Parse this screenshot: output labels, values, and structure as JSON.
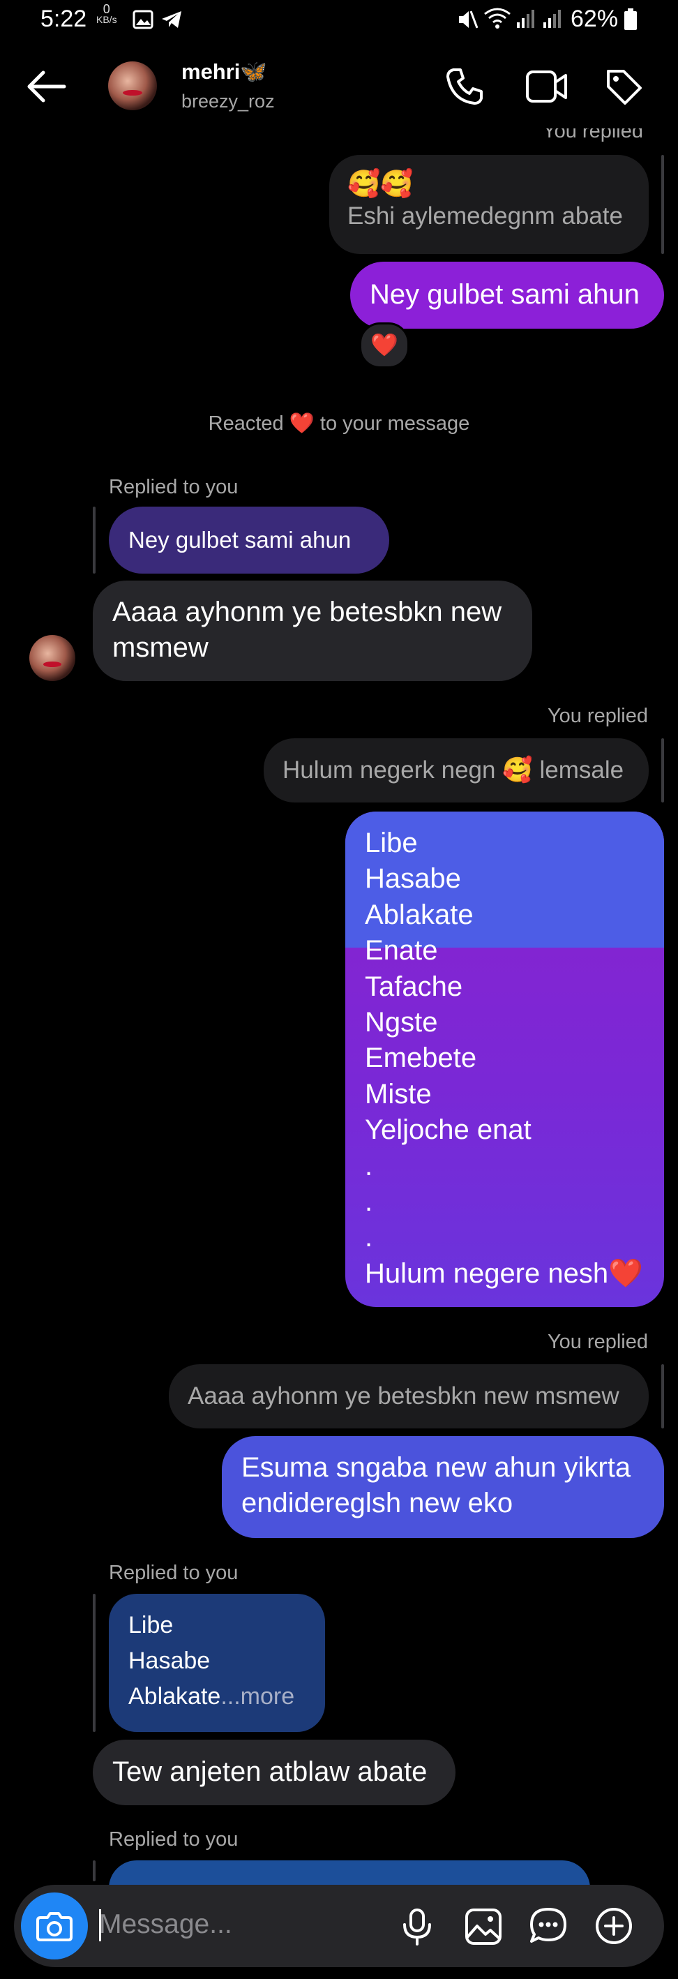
{
  "status_bar": {
    "time": "5:22",
    "speed_value": "0",
    "speed_unit": "KB/s",
    "battery": "62%"
  },
  "header": {
    "name": "mehri🦋",
    "username": "breezy_roz"
  },
  "thread": {
    "top_reply_label": "You replied",
    "top_quote_emojis": "🥰🥰",
    "top_quote_text": "Eshi aylemedegnm abate",
    "msg1": "Ney gulbet sami ahun",
    "msg1_reaction": "❤️",
    "reaction_notice_pre": "Reacted",
    "reaction_notice_emoji": "❤️",
    "reaction_notice_post": "to your message",
    "replied_to_you_1": "Replied to you",
    "their_quote_1": "Ney gulbet sami ahun",
    "their_msg_1_line1": "Aaaa ayhonm ye betesbkn new",
    "their_msg_1_line2": "msmew",
    "you_replied_2": "You replied",
    "quote_2": "Hulum negerk negn 🥰 lemsale",
    "list_lines": [
      "Libe",
      "Hasabe",
      "Ablakate",
      "Enate",
      "Tafache",
      "Ngste",
      "Emebete",
      "Miste",
      "Yeljoche enat",
      ".",
      ".",
      ".",
      "Hulum negere nesh❤️"
    ],
    "you_replied_3": "You replied",
    "quote_3": "Aaaa ayhonm ye betesbkn new msmew",
    "msg3_line1": "Esuma sngaba new ahun yikrta",
    "msg3_line2": "endidereglsh new eko",
    "replied_to_you_2": "Replied to you",
    "their_quote_2_lines": [
      "Libe",
      "Hasabe",
      "Ablakate"
    ],
    "their_quote_2_more": "...more",
    "their_msg_2": "Tew anjeten atblaw abate",
    "replied_to_you_3": "Replied to you"
  },
  "composer": {
    "placeholder": "Message..."
  },
  "colors": {
    "my_bubble_top": "#4d5de6",
    "my_bubble_bottom": "#8a24d2",
    "their_bubble": "#26262a",
    "quote_bubble": "#1b1b1d",
    "camera_button": "#1f86f5",
    "heart": "#e0162b"
  }
}
